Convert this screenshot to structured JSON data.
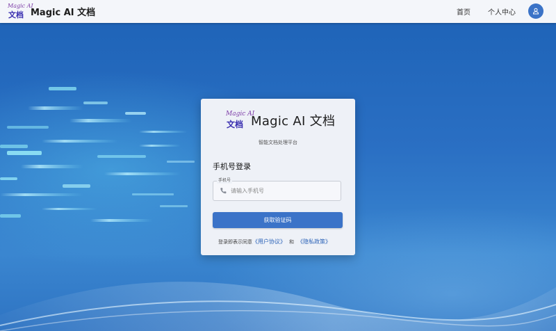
{
  "colors": {
    "accent": "#3b73c8",
    "topbar_bg": "#f4f6fa",
    "card_bg": "#eef1f7",
    "link": "#2c63b8",
    "logo_purple": "#7b3aa6"
  },
  "header": {
    "logo": {
      "script_text": "Magic AI",
      "chinese_text": "文档",
      "icon": "magic-ai-logo-icon"
    },
    "brand_name": "Magic AI 文档",
    "nav": [
      {
        "label": "首页"
      },
      {
        "label": "个人中心"
      }
    ],
    "avatar_icon": "user-icon"
  },
  "login_card": {
    "logo": {
      "script_text": "Magic AI",
      "chinese_text": "文档"
    },
    "title": "Magic AI 文档",
    "subtitle": "智能文档处理平台",
    "heading": "手机号登录",
    "phone_field": {
      "label": "手机号",
      "placeholder": "请输入手机号",
      "value": "",
      "icon": "phone-icon"
    },
    "submit_label": "获取验证码",
    "agreement": {
      "prefix": "登录即表示同意",
      "user_agreement": "《用户协议》",
      "and": "和",
      "privacy_policy": "《隐私政策》"
    }
  }
}
